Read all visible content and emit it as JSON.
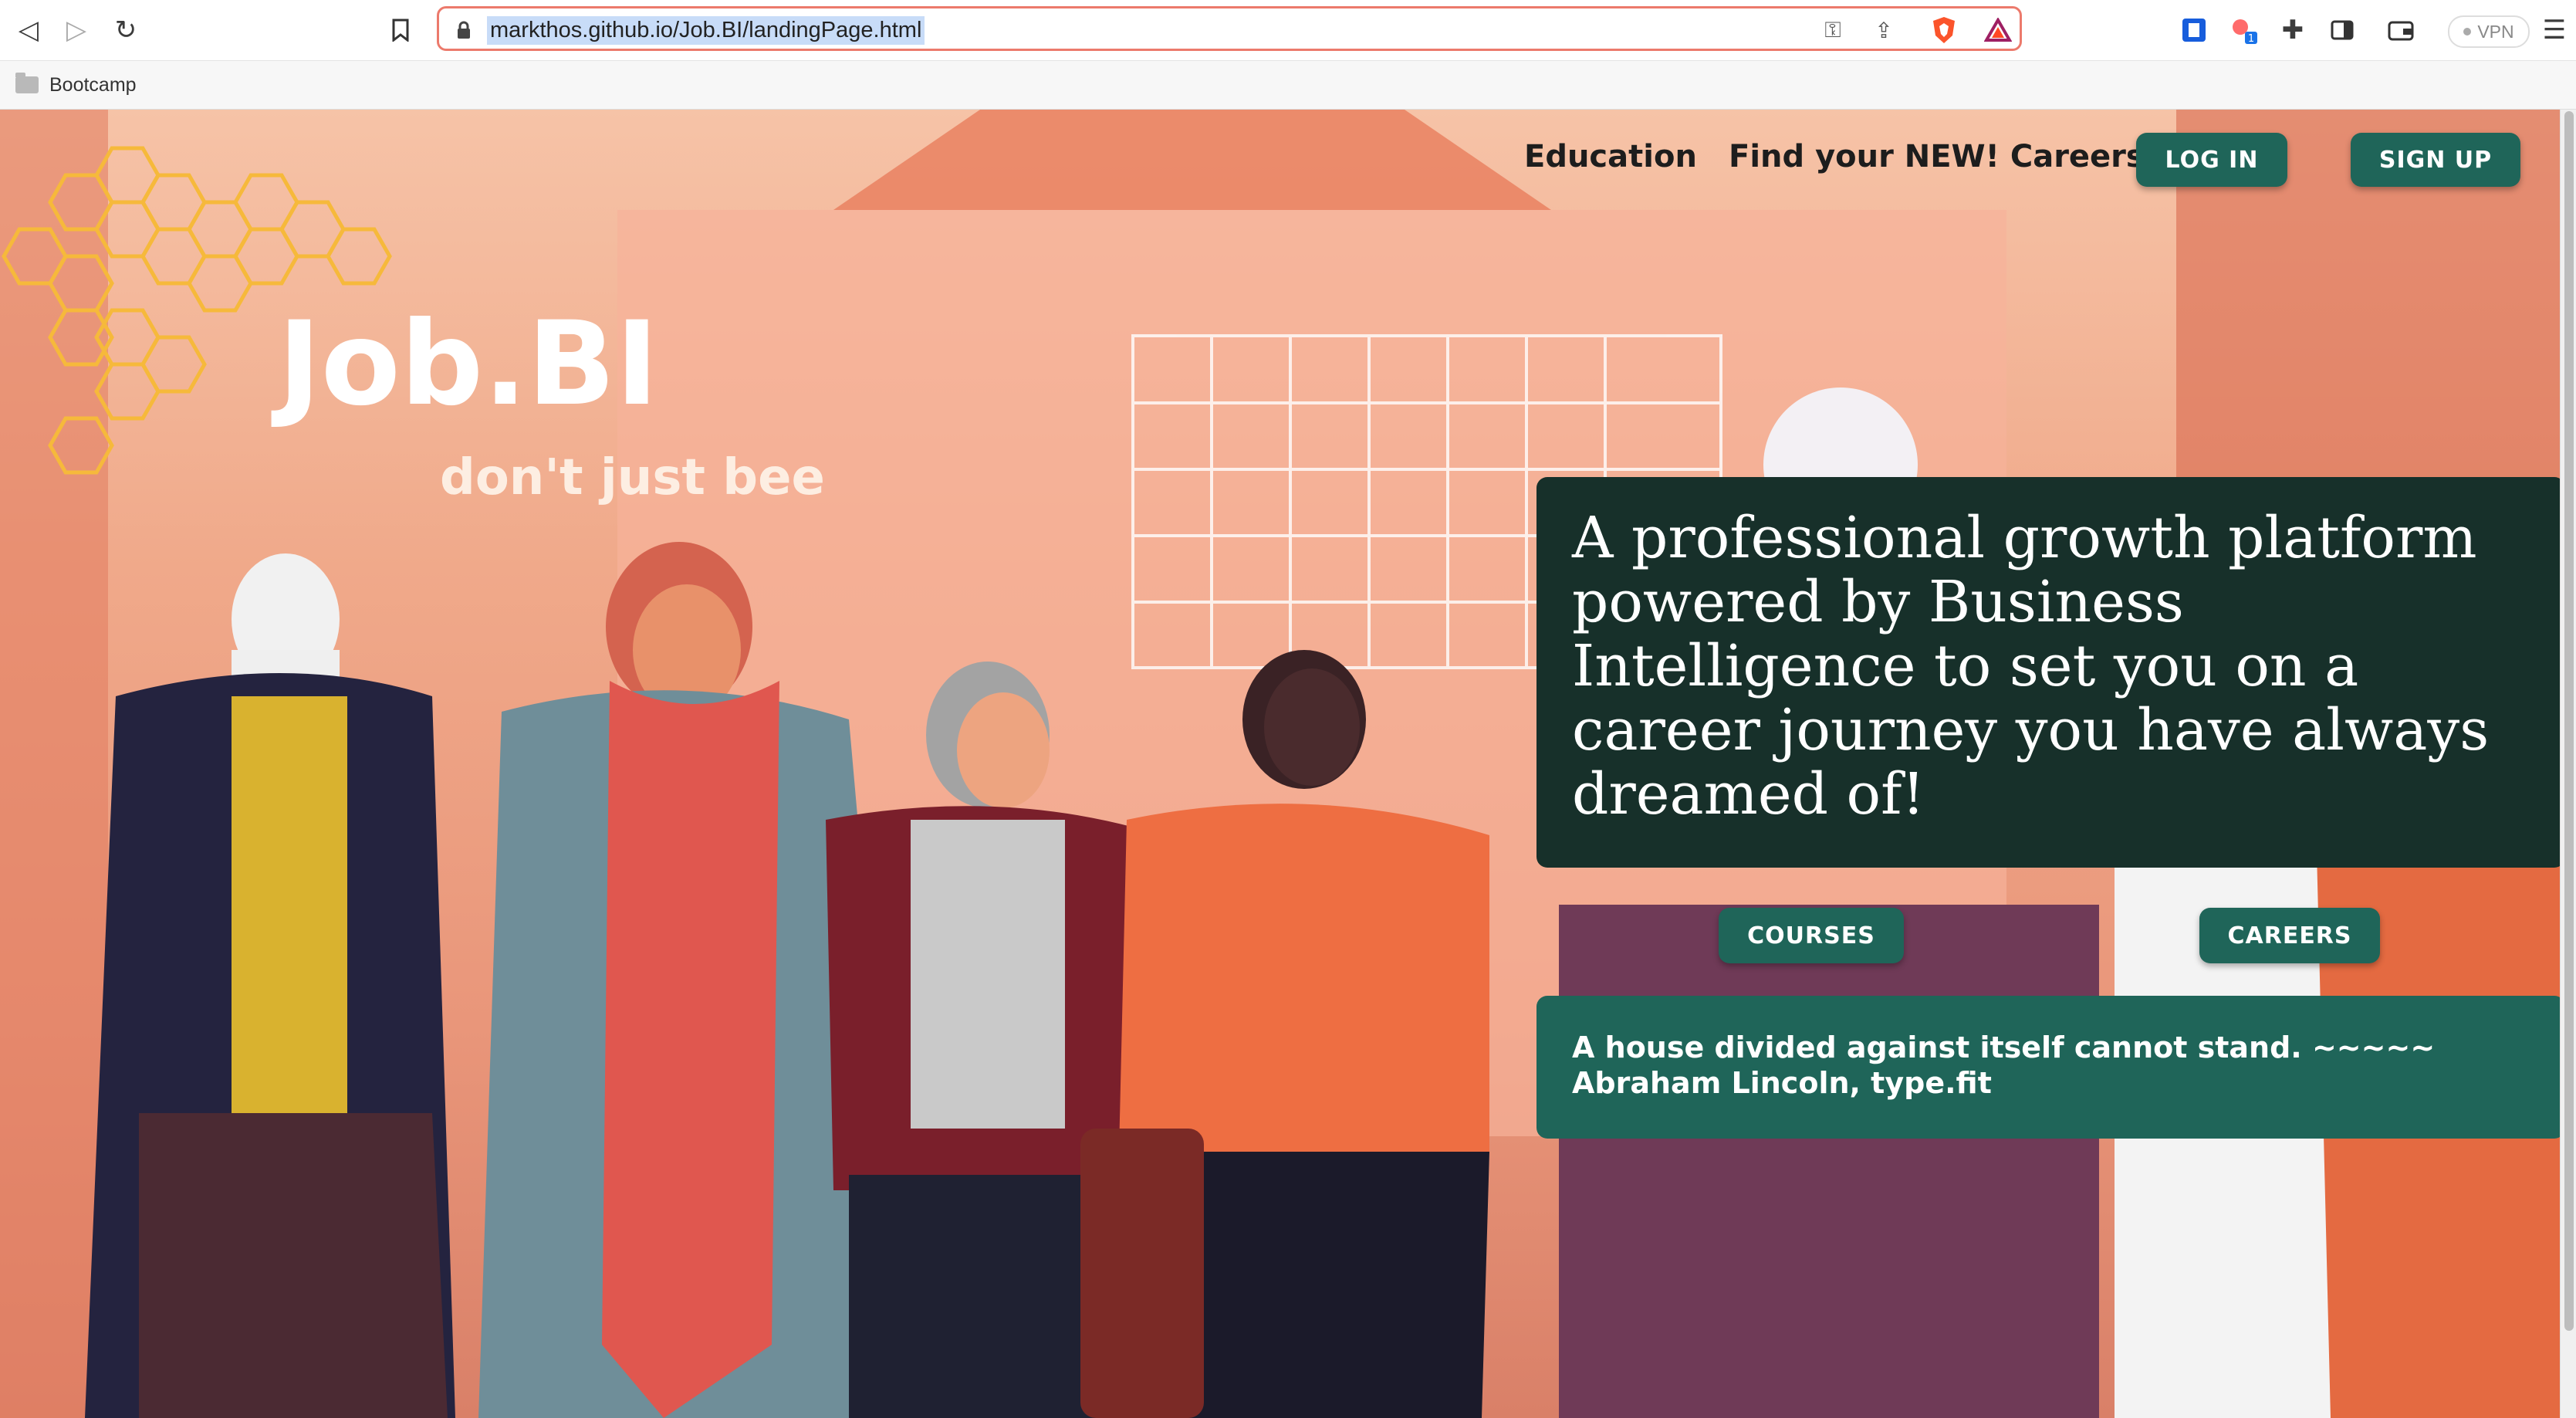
{
  "browser": {
    "url": "markthos.github.io/Job.BI/landingPage.html",
    "bookmark_folder": "Bootcamp",
    "vpn_label": "VPN",
    "extension_badge": "1"
  },
  "nav": {
    "education": "Education",
    "careers_link": "Find your NEW! Careers",
    "login": "LOG IN",
    "signup": "SIGN UP"
  },
  "logo": {
    "name": "Job.BI",
    "tagline": "don't just bee"
  },
  "hero": {
    "headline": "A professional growth platform powered by Business Intelligence to set you on a career journey you have always dreamed of!"
  },
  "actions": {
    "courses": "COURSES",
    "careers": "CAREERS"
  },
  "quote": {
    "text": "A house divided against itself cannot stand. ~~~~~ Abraham Lincoln, type.fit"
  },
  "colors": {
    "accent": "#1f6559",
    "hero_card": "#17302a",
    "background": "#f0a98a"
  }
}
